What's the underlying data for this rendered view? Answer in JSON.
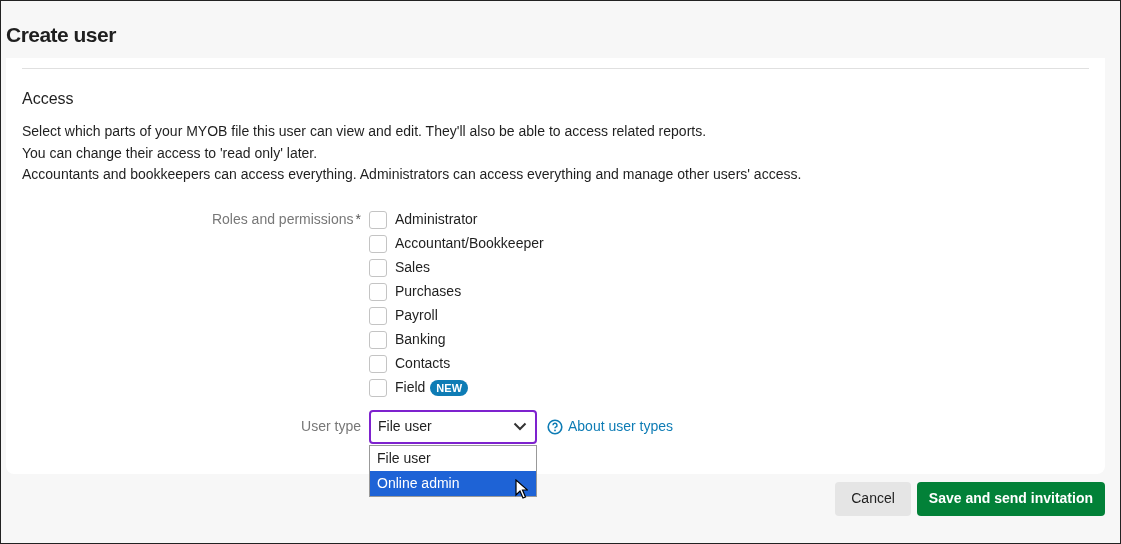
{
  "page_title": "Create user",
  "section": {
    "heading": "Access",
    "paragraphs": [
      "Select which parts of your MYOB file this user can view and edit. They'll also be able to access related reports.",
      "You can change their access to 'read only' later.",
      "Accountants and bookkeepers can access everything. Administrators can access everything and manage other users' access."
    ]
  },
  "roles": {
    "label": "Roles and permissions",
    "required_mark": "*",
    "options": [
      {
        "label": "Administrator",
        "checked": false
      },
      {
        "label": "Accountant/Bookkeeper",
        "checked": false
      },
      {
        "label": "Sales",
        "checked": false
      },
      {
        "label": "Purchases",
        "checked": false
      },
      {
        "label": "Payroll",
        "checked": false
      },
      {
        "label": "Banking",
        "checked": false
      },
      {
        "label": "Contacts",
        "checked": false
      },
      {
        "label": "Field",
        "checked": false,
        "badge": "NEW"
      }
    ]
  },
  "user_type": {
    "label": "User type",
    "value": "File user",
    "expanded": true,
    "help_link": "About user types",
    "options": [
      {
        "label": "File user",
        "highlighted": false
      },
      {
        "label": "Online admin",
        "highlighted": true
      }
    ]
  },
  "buttons": [
    {
      "label": "Cancel",
      "kind": "secondary"
    },
    {
      "label": "Save and send invitation",
      "kind": "primary"
    }
  ]
}
